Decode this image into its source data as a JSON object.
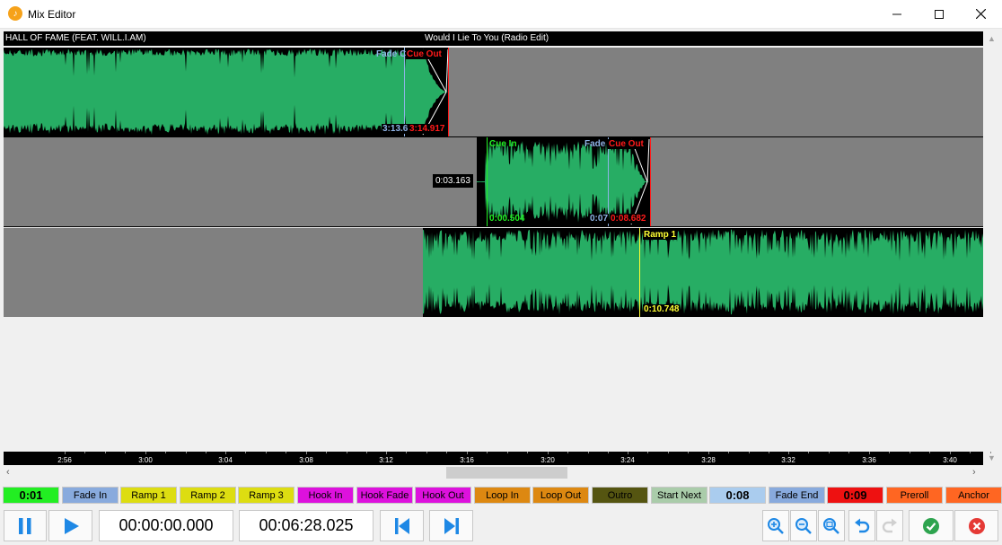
{
  "window": {
    "title": "Mix Editor",
    "icon": "app-logo-icon"
  },
  "tracks": {
    "left_title": "HALL OF FAME (FEAT. WILL.I.AM)",
    "center_title": "Would I Lie To You (Radio Edit)",
    "track1": {
      "fade_label": "Fade C",
      "cue_out_label": "Cue Out",
      "fade_time": "3:13.6",
      "cue_out_time": "3:14.917"
    },
    "track2": {
      "cue_in_label": "Cue In",
      "fade_label": "Fade",
      "cue_out_label": "Cue Out",
      "cue_in_time": "0:00.504",
      "fade_time": "0:07",
      "cue_out_time": "0:08.682",
      "gap_time": "0:03.163"
    },
    "track3": {
      "ramp_label": "Ramp 1",
      "ramp_time": "0:10.748"
    }
  },
  "timeline": {
    "ticks": [
      "2:56",
      "3:00",
      "3:04",
      "3:08",
      "3:12",
      "3:16",
      "3:20",
      "3:24",
      "3:28",
      "3:32",
      "3:36",
      "3:40"
    ]
  },
  "markers": [
    {
      "label": "0:01",
      "bg": "#22ee22",
      "fg": "#000000",
      "bold": true,
      "name": "marker-cue-in-time"
    },
    {
      "label": "Fade In",
      "bg": "#88aadd",
      "fg": "#000000",
      "bold": false,
      "name": "marker-fade-in"
    },
    {
      "label": "Ramp 1",
      "bg": "#dddd11",
      "fg": "#000000",
      "bold": false,
      "name": "marker-ramp-1"
    },
    {
      "label": "Ramp 2",
      "bg": "#dddd11",
      "fg": "#000000",
      "bold": false,
      "name": "marker-ramp-2"
    },
    {
      "label": "Ramp 3",
      "bg": "#dddd11",
      "fg": "#000000",
      "bold": false,
      "name": "marker-ramp-3"
    },
    {
      "label": "Hook In",
      "bg": "#dd11dd",
      "fg": "#000000",
      "bold": false,
      "name": "marker-hook-in"
    },
    {
      "label": "Hook Fade",
      "bg": "#dd11dd",
      "fg": "#000000",
      "bold": false,
      "name": "marker-hook-fade"
    },
    {
      "label": "Hook Out",
      "bg": "#dd11dd",
      "fg": "#000000",
      "bold": false,
      "name": "marker-hook-out"
    },
    {
      "label": "Loop In",
      "bg": "#dd8811",
      "fg": "#000000",
      "bold": false,
      "name": "marker-loop-in"
    },
    {
      "label": "Loop Out",
      "bg": "#dd8811",
      "fg": "#000000",
      "bold": false,
      "name": "marker-loop-out"
    },
    {
      "label": "Outro",
      "bg": "#555511",
      "fg": "#000000",
      "bold": false,
      "name": "marker-outro"
    },
    {
      "label": "Start Next",
      "bg": "#aaccaa",
      "fg": "#000000",
      "bold": false,
      "name": "marker-start-next"
    },
    {
      "label": "0:08",
      "bg": "#aaccee",
      "fg": "#000000",
      "bold": true,
      "name": "marker-fade-end-time"
    },
    {
      "label": "Fade End",
      "bg": "#88aadd",
      "fg": "#000000",
      "bold": false,
      "name": "marker-fade-end"
    },
    {
      "label": "0:09",
      "bg": "#ee1111",
      "fg": "#000000",
      "bold": true,
      "name": "marker-cue-out-time"
    },
    {
      "label": "Preroll",
      "bg": "#ff6622",
      "fg": "#000000",
      "bold": false,
      "name": "marker-preroll"
    },
    {
      "label": "Anchor",
      "bg": "#ff6622",
      "fg": "#000000",
      "bold": false,
      "name": "marker-anchor"
    }
  ],
  "transport": {
    "position": "00:00:00.000",
    "duration": "00:06:28.025",
    "icons": [
      "pause-icon",
      "play-icon",
      "skip-start-icon",
      "skip-end-icon"
    ]
  },
  "tools": {
    "icons": [
      "zoom-in-icon",
      "zoom-out-icon",
      "zoom-fit-icon",
      "undo-icon",
      "redo-icon",
      "ok-icon",
      "cancel-icon"
    ]
  },
  "colors": {
    "waveform": "#27ad64",
    "lane": "#808080",
    "fade": "#8fb3e6",
    "cue_in": "#22ee22",
    "cue_out": "#ff1a1a",
    "ramp": "#ffff33",
    "accent": "#1e88e5"
  }
}
